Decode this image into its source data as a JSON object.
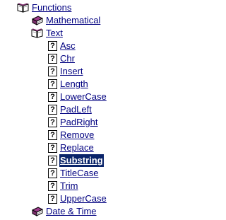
{
  "tree": {
    "functions": {
      "label": "Functions",
      "icon": "open-book-icon"
    },
    "mathematical": {
      "label": "Mathematical",
      "icon": "closed-book-icon"
    },
    "text": {
      "label": "Text",
      "icon": "open-book-icon"
    },
    "text_items": [
      {
        "label": "Asc",
        "icon": "help-topic-icon"
      },
      {
        "label": "Chr",
        "icon": "help-topic-icon"
      },
      {
        "label": "Insert",
        "icon": "help-topic-icon"
      },
      {
        "label": "Length",
        "icon": "help-topic-icon"
      },
      {
        "label": "LowerCase",
        "icon": "help-topic-icon"
      },
      {
        "label": "PadLeft",
        "icon": "help-topic-icon"
      },
      {
        "label": "PadRight",
        "icon": "help-topic-icon"
      },
      {
        "label": "Remove",
        "icon": "help-topic-icon"
      },
      {
        "label": "Replace",
        "icon": "help-topic-icon"
      },
      {
        "label": "Substring",
        "icon": "help-topic-icon",
        "selected": true
      },
      {
        "label": "TitleCase",
        "icon": "help-topic-icon"
      },
      {
        "label": "Trim",
        "icon": "help-topic-icon"
      },
      {
        "label": "UpperCase",
        "icon": "help-topic-icon"
      }
    ],
    "date_time": {
      "label": "Date & Time",
      "icon": "closed-book-icon"
    },
    "help_topic_glyph": "?"
  },
  "colors": {
    "link": "#000080",
    "selection_bg": "#0a246a",
    "selection_fg": "#ffffff",
    "book_cover": "#7b2d6b"
  }
}
